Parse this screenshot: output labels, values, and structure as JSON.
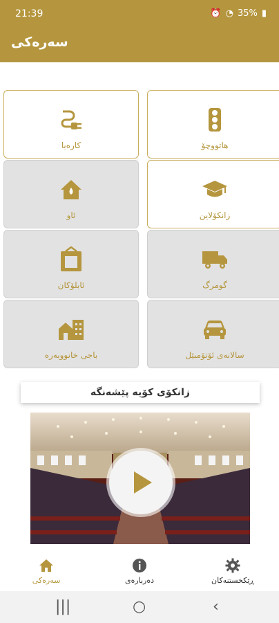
{
  "status": {
    "time": "21:39",
    "battery": "35%"
  },
  "appbar": {
    "title": "سەرەکی"
  },
  "colors": {
    "accent": "#b5963e"
  },
  "tiles": [
    {
      "label": "کارەبا",
      "icon": "plug-icon",
      "state": "active"
    },
    {
      "label": "هاتووچۆ",
      "icon": "traffic-light-icon",
      "state": "active"
    },
    {
      "label": "ئاو",
      "icon": "water-house-icon",
      "state": "inactive"
    },
    {
      "label": "زانکۆلاین",
      "icon": "graduation-cap-icon",
      "state": "active"
    },
    {
      "label": "ئابلۆکان",
      "icon": "box-icon",
      "state": "inactive"
    },
    {
      "label": "گومرگ",
      "icon": "truck-icon",
      "state": "inactive"
    },
    {
      "label": "باجی خانووبەرە",
      "icon": "buildings-icon",
      "state": "inactive"
    },
    {
      "label": "سالانەی ئۆتۆمبێل",
      "icon": "car-icon",
      "state": "inactive"
    }
  ],
  "section": {
    "heading": "زانکۆی کۆیە پێشەنگە"
  },
  "bottom_nav": [
    {
      "label": "سەرەکی",
      "icon": "home-icon",
      "active": true
    },
    {
      "label": "دەربارەی",
      "icon": "info-icon",
      "active": false
    },
    {
      "label": "ڕێکخستنەکان",
      "icon": "gear-icon",
      "active": false
    }
  ]
}
